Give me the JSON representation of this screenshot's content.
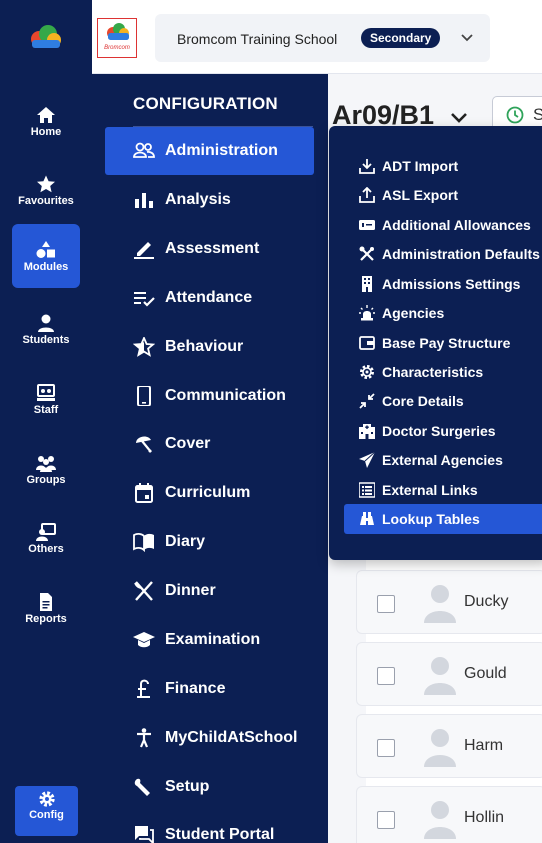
{
  "rail": {
    "items": [
      {
        "label": "Home",
        "icon": "home-icon"
      },
      {
        "label": "Favourites",
        "icon": "star-icon"
      },
      {
        "label": "Modules",
        "icon": "shapes-icon",
        "active": true
      },
      {
        "label": "Students",
        "icon": "person-icon"
      },
      {
        "label": "Staff",
        "icon": "staff-icon"
      },
      {
        "label": "Groups",
        "icon": "groups-icon"
      },
      {
        "label": "Others",
        "icon": "others-icon"
      },
      {
        "label": "Reports",
        "icon": "document-icon"
      }
    ],
    "config_label": "Config"
  },
  "header": {
    "school_logo_text": "Bromcom",
    "school_name": "Bromcom Training School",
    "school_badge": "Secondary"
  },
  "config_menu": {
    "title": "CONFIGURATION",
    "items": [
      {
        "label": "Administration",
        "icon": "people-icon",
        "active": true
      },
      {
        "label": "Analysis",
        "icon": "bar-chart-icon"
      },
      {
        "label": "Assessment",
        "icon": "pencil-icon"
      },
      {
        "label": "Attendance",
        "icon": "list-check-icon"
      },
      {
        "label": "Behaviour",
        "icon": "star-outline-icon"
      },
      {
        "label": "Communication",
        "icon": "phone-icon"
      },
      {
        "label": "Cover",
        "icon": "cover-icon"
      },
      {
        "label": "Curriculum",
        "icon": "calendar-icon"
      },
      {
        "label": "Diary",
        "icon": "book-icon"
      },
      {
        "label": "Dinner",
        "icon": "cutlery-icon"
      },
      {
        "label": "Examination",
        "icon": "mortarboard-icon"
      },
      {
        "label": "Finance",
        "icon": "pound-icon"
      },
      {
        "label": "MyChildAtSchool",
        "icon": "child-icon"
      },
      {
        "label": "Setup",
        "icon": "wrench-icon"
      },
      {
        "label": "Student Portal",
        "icon": "chat-icon"
      }
    ]
  },
  "main": {
    "class_title": "Ar09/B1",
    "filter_text": "S",
    "students": [
      "Ducky",
      "Gould",
      "Harm",
      "Hollin"
    ]
  },
  "flyout": {
    "items": [
      {
        "label": "ADT Import",
        "icon": "import-icon"
      },
      {
        "label": "ASL Export",
        "icon": "export-icon"
      },
      {
        "label": "Additional Allowances",
        "icon": "money-icon"
      },
      {
        "label": "Administration Defaults",
        "icon": "tools-icon"
      },
      {
        "label": "Admissions Settings",
        "icon": "building-icon"
      },
      {
        "label": "Agencies",
        "icon": "siren-icon"
      },
      {
        "label": "Base Pay Structure",
        "icon": "pay-icon"
      },
      {
        "label": "Characteristics",
        "icon": "cog-icon"
      },
      {
        "label": "Core Details",
        "icon": "compress-icon"
      },
      {
        "label": "Doctor Surgeries",
        "icon": "hospital-icon"
      },
      {
        "label": "External Agencies",
        "icon": "send-icon"
      },
      {
        "label": "External Links",
        "icon": "links-icon"
      },
      {
        "label": "Lookup Tables",
        "icon": "binoculars-icon",
        "active": true
      }
    ]
  },
  "colors": {
    "navy": "#0c1f53",
    "accent": "#2557d6"
  }
}
